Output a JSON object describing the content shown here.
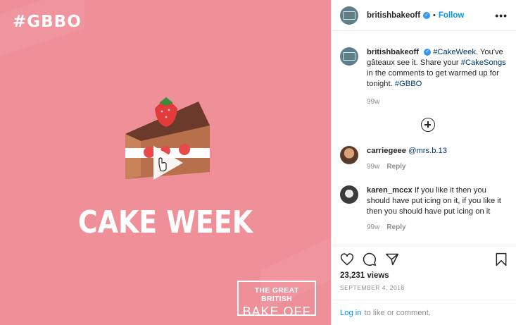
{
  "media": {
    "hashtag": "#GBBO",
    "title": "CAKE WEEK",
    "brand_line1": "THE GREAT BRITISH",
    "brand_line2": "BAKE OFF"
  },
  "header": {
    "username": "britishbakeoff",
    "separator": "•",
    "follow_label": "Follow",
    "more_label": "•••"
  },
  "caption": {
    "username": "britishbakeoff",
    "segments": [
      {
        "text": "#CakeWeek",
        "link": true
      },
      {
        "text": ". You've gâteaux see it. Share your ",
        "link": false
      },
      {
        "text": "#CakeSongs",
        "link": true
      },
      {
        "text": " in the comments to get warmed up for tonight. ",
        "link": false
      },
      {
        "text": "#GBBO",
        "link": true
      }
    ],
    "age": "99w"
  },
  "comments": [
    {
      "username": "carriegeee",
      "mention": "@mrs.b.13",
      "text": "",
      "age": "99w",
      "reply_label": "Reply"
    },
    {
      "username": "karen_mccx",
      "mention": "",
      "text": "If you like it then you should have put icing on it, if you like it then you should have put icing on it",
      "age": "99w",
      "reply_label": "Reply"
    }
  ],
  "stats": {
    "views": "23,231 views",
    "date": "SEPTEMBER 4, 2018"
  },
  "login": {
    "link_label": "Log in",
    "suffix": "to like or comment."
  },
  "colors": {
    "media_bg": "#ef8f98",
    "link": "#00376b",
    "follow": "#0095f6"
  }
}
